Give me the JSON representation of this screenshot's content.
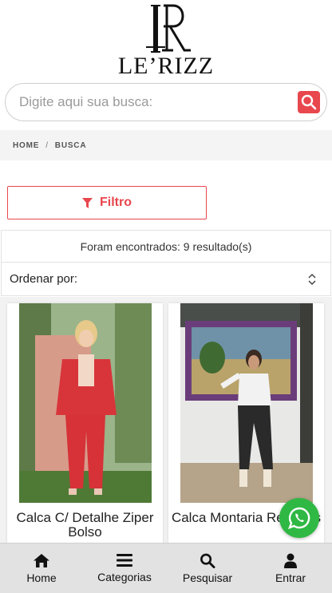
{
  "brand": {
    "name": "LE’RIZZ"
  },
  "search": {
    "placeholder": "Digite aqui sua busca:"
  },
  "breadcrumb": {
    "home": "HOME",
    "separator": "/",
    "current": "BUSCA"
  },
  "filter": {
    "label": "Filtro"
  },
  "results": {
    "text": "Foram encontrados: 9 resultado(s)"
  },
  "sort": {
    "label": "Ordenar por:"
  },
  "products": [
    {
      "name": "Calca C/ Detalhe Ziper Bolso"
    },
    {
      "name": "Calca Montaria Recortes"
    }
  ],
  "nav": {
    "home": "Home",
    "categories": "Categorias",
    "search": "Pesquisar",
    "login": "Entrar"
  },
  "colors": {
    "accent": "#e8474d",
    "whatsapp": "#2fb844",
    "nav_bg": "#e2e2e2"
  },
  "icons": [
    "search-icon",
    "filter-icon",
    "sort-arrows-icon",
    "whatsapp-icon",
    "home-icon",
    "menu-icon",
    "search-icon",
    "user-icon"
  ]
}
